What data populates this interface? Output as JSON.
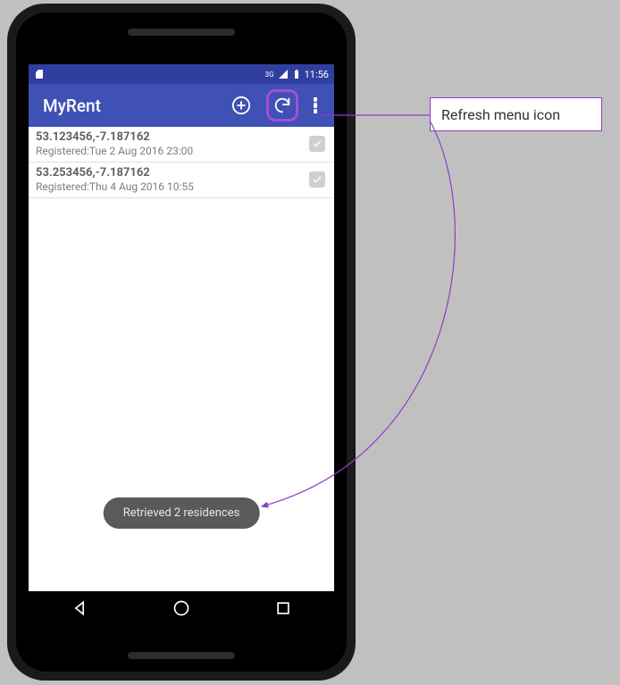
{
  "status": {
    "network_label": "3G",
    "time": "11:56"
  },
  "actionbar": {
    "title": "MyRent"
  },
  "list": [
    {
      "coords": "53.123456,-7.187162",
      "registered": "Registered:Tue 2 Aug 2016 23:00",
      "checked": true
    },
    {
      "coords": "53.253456,-7.187162",
      "registered": "Registered:Thu 4 Aug 2016 10:55",
      "checked": true
    }
  ],
  "toast": {
    "message": "Retrieved 2 residences"
  },
  "annotation": {
    "label": "Refresh menu icon"
  }
}
